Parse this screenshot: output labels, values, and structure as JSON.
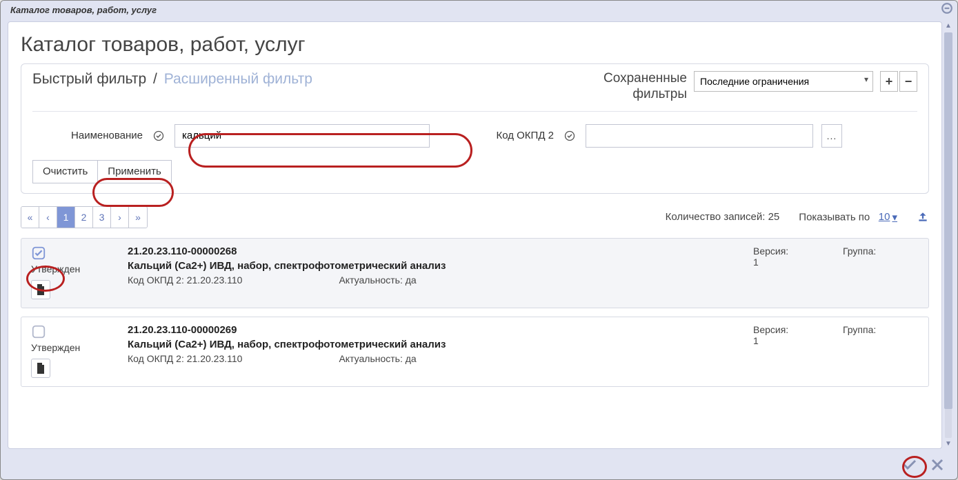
{
  "window_title": "Каталог товаров, работ, услуг",
  "page_title": "Каталог товаров, работ, услуг",
  "filter": {
    "tab_quick": "Быстрый фильтр",
    "tab_advanced": "Расширенный фильтр",
    "saved_label_line1": "Сохраненные",
    "saved_label_line2": "фильтры",
    "saved_selected": "Последние ограничения",
    "name_label": "Наименование",
    "name_value": "кальций",
    "kod_label": "Код ОКПД 2",
    "kod_value": "",
    "clear_btn": "Очистить",
    "apply_btn": "Применить"
  },
  "pager": {
    "first": "«",
    "prev": "‹",
    "pages": [
      "1",
      "2",
      "3"
    ],
    "next": "›",
    "last": "»",
    "active_index": 0
  },
  "list_meta": {
    "count_label": "Количество записей: 25",
    "show_label": "Показывать по",
    "show_value": "10"
  },
  "cards": [
    {
      "checked": true,
      "status": "Утвержден",
      "code": "21.20.23.110-00000268",
      "title": "Кальций (Ca2+) ИВД, набор, спектрофотометрический анализ",
      "okpd_label": "Код ОКПД 2: 21.20.23.110",
      "actual_label": "Актуальность: да",
      "version_label": "Версия:",
      "version_val": "1",
      "group_label": "Группа:"
    },
    {
      "checked": false,
      "status": "Утвержден",
      "code": "21.20.23.110-00000269",
      "title": "Кальций (Ca2+) ИВД, набор, спектрофотометрический анализ",
      "okpd_label": "Код ОКПД 2: 21.20.23.110",
      "actual_label": "Актуальность: да",
      "version_label": "Версия:",
      "version_val": "1",
      "group_label": "Группа:"
    }
  ]
}
